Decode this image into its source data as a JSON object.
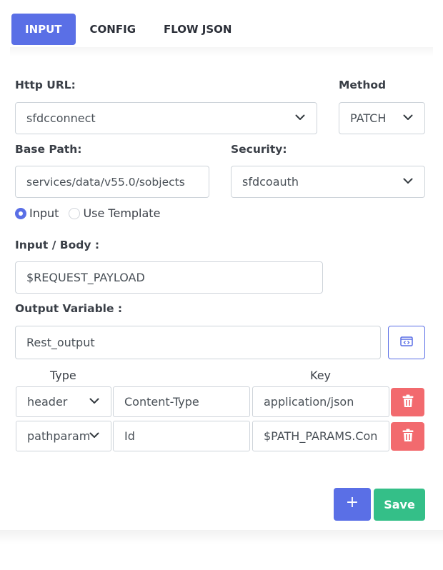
{
  "tabs": [
    {
      "label": "INPUT",
      "active": true
    },
    {
      "label": "CONFIG",
      "active": false
    },
    {
      "label": "FLOW JSON",
      "active": false
    }
  ],
  "form": {
    "http_url": {
      "label": "Http URL:",
      "value": "sfdcconnect"
    },
    "method": {
      "label": "Method",
      "value": "PATCH"
    },
    "base_path": {
      "label": "Base Path:",
      "value": "services/data/v55.0/sobjects"
    },
    "security": {
      "label": "Security:",
      "value": "sfdcoauth"
    },
    "mode": {
      "options": [
        {
          "label": "Input",
          "checked": true
        },
        {
          "label": "Use Template",
          "checked": false
        }
      ]
    },
    "input_body": {
      "label": "Input / Body :",
      "value": "$REQUEST_PAYLOAD"
    },
    "output_variable": {
      "label": "Output Variable :",
      "value": "Rest_output"
    }
  },
  "params": {
    "headers": [
      "Type",
      "Key"
    ],
    "rows": [
      {
        "type": "header",
        "key": "Content-Type",
        "value": "application/json"
      },
      {
        "type": "pathparam",
        "key": "Id",
        "value": "$PATH_PARAMS.Con"
      }
    ]
  },
  "actions": {
    "add_label": "+",
    "save_label": "Save"
  },
  "colors": {
    "primary": "#5a6fe6",
    "success": "#34bf88",
    "danger": "#f26a6e"
  },
  "icons": {
    "dropdown": "chevron-down-icon",
    "delete": "trash-icon",
    "code": "code-window-icon"
  }
}
